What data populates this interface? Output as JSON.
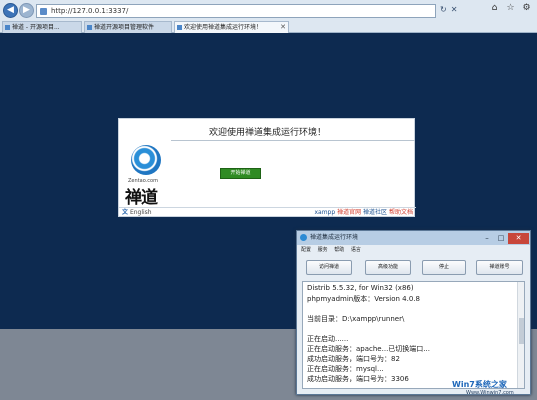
{
  "browser": {
    "address": "http://127.0.0.1:3337/",
    "tabs": [
      {
        "label": "禅道 - 开源项目..."
      },
      {
        "label": "禅道开源项目管理软件"
      },
      {
        "label": "欢迎使用禅道集成运行环境！"
      }
    ]
  },
  "page": {
    "title": "欢迎使用禅道集成运行环境！",
    "logo_small": "Zentao.com",
    "logo_cn": "禅道",
    "start_button": "开始禅道",
    "language": "English",
    "footer_links": {
      "xampp": "xampp",
      "official": "禅道官网",
      "community": "禅道社区",
      "help": "帮助文档"
    }
  },
  "dialog": {
    "title": "禅道集成运行环境",
    "menu": [
      "配置",
      "服务",
      "帮助",
      "语言"
    ],
    "buttons": {
      "access": "访问禅道",
      "advanced": "高级功能",
      "stop": "停止",
      "account": "禅道账号"
    },
    "log": [
      "Distrib 5.5.32, for Win32 (x86)",
      "phpmyadmin版本：Version 4.0.8",
      "",
      "当前目录：D:\\xampp\\runner\\",
      "",
      "正在启动......",
      "正在启动服务：apache...已切换端口...",
      "成功启动服务，端口号为：82",
      "正在启动服务：mysql...",
      "成功启动服务，端口号为：3306"
    ]
  },
  "watermark": {
    "brand": "Win7系统之家",
    "url": "Www.Winwin7.com"
  }
}
